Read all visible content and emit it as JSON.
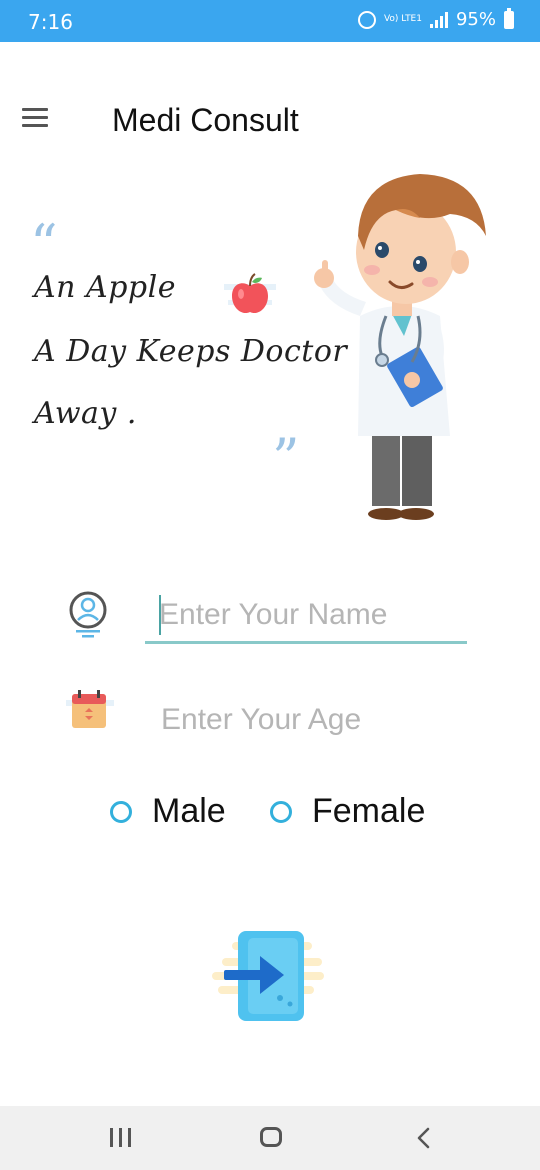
{
  "status_bar": {
    "time": "7:16",
    "network_label": "Vo) LTE1",
    "battery": "95%"
  },
  "app_bar": {
    "title": "Medi Consult",
    "menu_icon": "hamburger-menu-icon"
  },
  "quote": {
    "line1": "An Apple",
    "line2": "A Day Keeps Doctor",
    "line3": "Away .",
    "icon": "apple-icon",
    "open_mark": "“",
    "close_mark": "”"
  },
  "illustration": "doctor-illustration",
  "form": {
    "name_placeholder": "Enter Your Name",
    "name_value": "",
    "name_icon": "user-icon",
    "age_placeholder": "Enter Your Age",
    "age_value": "",
    "age_icon": "calendar-icon",
    "gender_options": [
      "Male",
      "Female"
    ],
    "submit_icon": "login-icon"
  },
  "colors": {
    "status_bar": "#3aa6ef",
    "radio": "#33b0dc",
    "name_underline": "#89c9c9",
    "placeholder": "#b5b5b5"
  }
}
